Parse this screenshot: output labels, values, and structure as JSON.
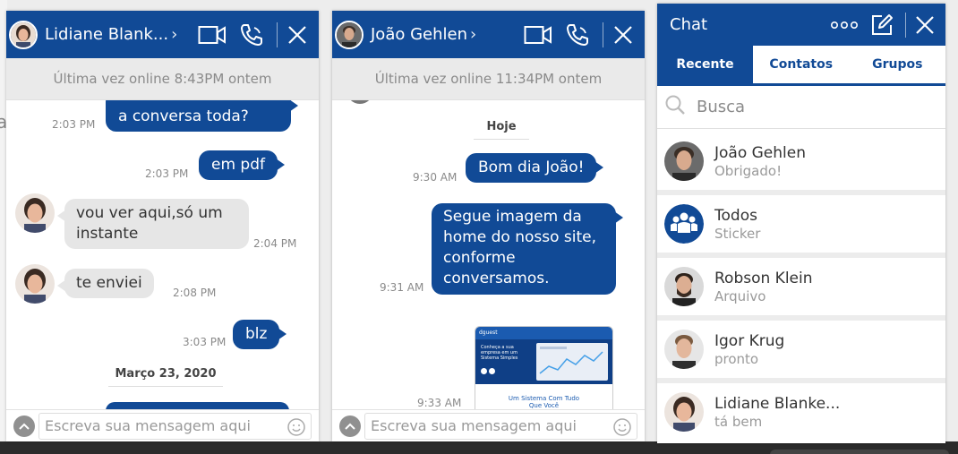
{
  "window_left": {
    "contact_name": "Lidiane Blank...",
    "status": "Última vez online 8:43PM ontem",
    "messages": {
      "m1_text": "a conversa toda?",
      "m1_time": "2:03 PM",
      "m2_text": "em pdf",
      "m2_time": "2:03 PM",
      "m3_text": "vou ver aqui,só um instante",
      "m3_time": "2:04 PM",
      "m4_text": "te enviei",
      "m4_time": "2:08 PM",
      "m5_text": "blz",
      "m5_time": "3:03 PM"
    },
    "date_separator": "Março 23, 2020",
    "compose_placeholder": "Escreva sua mensagem aqui"
  },
  "window_middle": {
    "contact_name": "João Gehlen",
    "status": "Última vez online 11:34PM ontem",
    "date_separator": "Hoje",
    "messages": {
      "m1_text": "Bom dia João!",
      "m1_time": "9:30 AM",
      "m2_text": "Segue imagem da home do nosso site, conforme conversamos.",
      "m2_time": "9:31 AM",
      "m3_time": "9:33 AM"
    },
    "image_preview": {
      "logo": "dguest",
      "headline": "Conheça a sua empresa em um Sistema Simples",
      "caption": "Um Sistema Com Tudo Que Você"
    },
    "compose_placeholder": "Escreva sua mensagem aqui"
  },
  "sidebar": {
    "title": "Chat",
    "tabs": [
      "Recente",
      "Contatos",
      "Grupos"
    ],
    "search_placeholder": "Busca",
    "contacts": [
      {
        "name": "João Gehlen",
        "last": "Obrigado!"
      },
      {
        "name": "Todos",
        "last": "Sticker"
      },
      {
        "name": "Robson Klein",
        "last": "Arquivo"
      },
      {
        "name": "Igor Krug",
        "last": "pronto"
      },
      {
        "name": "Lidiane Blanke...",
        "last": "tá bem"
      }
    ]
  },
  "colors": {
    "brand": "#114a96",
    "bubble_in": "#e6e6e6",
    "status_bar": "#eaeaea"
  }
}
